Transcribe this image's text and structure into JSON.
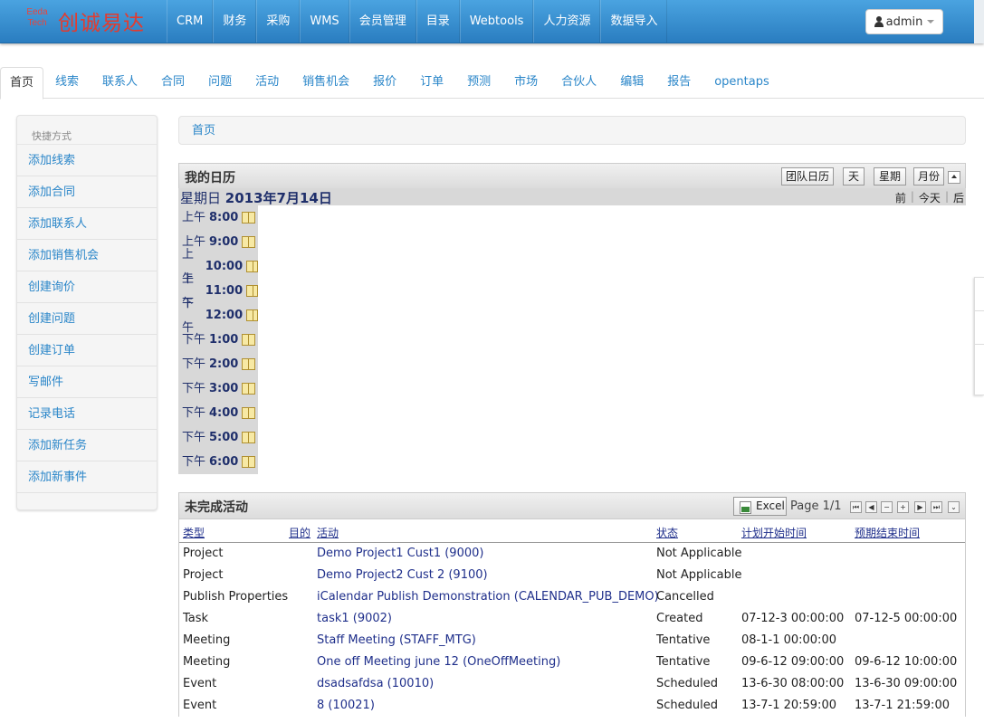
{
  "brand": {
    "logo_text": "创诚易达",
    "logo_small_1": "Eeda",
    "logo_small_2": "Tech"
  },
  "nav": [
    "CRM",
    "财务",
    "采购",
    "WMS",
    "会员管理",
    "目录",
    "Webtools",
    "人力资源",
    "数据导入"
  ],
  "user": {
    "name": "admin"
  },
  "tabs": [
    "首页",
    "线索",
    "联系人",
    "合同",
    "问题",
    "活动",
    "销售机会",
    "报价",
    "订单",
    "预测",
    "市场",
    "合伙人",
    "编辑",
    "报告",
    "opentaps"
  ],
  "sidebar": {
    "header": "快捷方式",
    "items": [
      "添加线索",
      "添加合同",
      "添加联系人",
      "添加销售机会",
      "创建询价",
      "创建问题",
      "创建订单",
      "写邮件",
      "记录电话",
      "添加新任务",
      "添加新事件"
    ]
  },
  "breadcrumb": "首页",
  "calendar": {
    "title": "我的日历",
    "buttons": {
      "team": "团队日历",
      "day": "天",
      "week": "星期",
      "month": "月份"
    },
    "weekday": "星期日",
    "date": "2013年7月14日",
    "nav": {
      "prev": "前",
      "today": "今天",
      "next": "后"
    },
    "hours": [
      {
        "period": "上午",
        "time": "8:00"
      },
      {
        "period": "上午",
        "time": "9:00"
      },
      {
        "period": "上午",
        "time": "10:00"
      },
      {
        "period": "上午",
        "time": "11:00"
      },
      {
        "period": "下午",
        "time": "12:00"
      },
      {
        "period": "下午",
        "time": "1:00"
      },
      {
        "period": "下午",
        "time": "2:00"
      },
      {
        "period": "下午",
        "time": "3:00"
      },
      {
        "period": "下午",
        "time": "4:00"
      },
      {
        "period": "下午",
        "time": "5:00"
      },
      {
        "period": "下午",
        "time": "6:00"
      }
    ]
  },
  "activities": {
    "title": "未完成活动",
    "excel_label": "Excel",
    "page_label": "Page 1/1",
    "columns": {
      "type": "类型",
      "purpose": "目的",
      "activity": "活动",
      "status": "状态",
      "start": "计划开始时间",
      "end": "预期结束时间"
    },
    "rows": [
      {
        "type": "Project",
        "activity": "Demo Project1 Cust1 (9000)",
        "status": "Not Applicable",
        "start": "",
        "end": ""
      },
      {
        "type": "Project",
        "activity": "Demo Project2 Cust 2 (9100)",
        "status": "Not Applicable",
        "start": "",
        "end": ""
      },
      {
        "type": "Publish Properties",
        "activity": "iCalendar Publish Demonstration (CALENDAR_PUB_DEMO)",
        "status": "Cancelled",
        "start": "",
        "end": ""
      },
      {
        "type": "Task",
        "activity": "task1 (9002)",
        "status": "Created",
        "start": "07-12-3 00:00:00",
        "end": "07-12-5 00:00:00"
      },
      {
        "type": "Meeting",
        "activity": "Staff Meeting (STAFF_MTG)",
        "status": "Tentative",
        "start": "08-1-1 00:00:00",
        "end": ""
      },
      {
        "type": "Meeting",
        "activity": "One off Meeting june 12 (OneOffMeeting)",
        "status": "Tentative",
        "start": "09-6-12 09:00:00",
        "end": "09-6-12 10:00:00"
      },
      {
        "type": "Event",
        "activity": "dsadsafdsa (10010)",
        "status": "Scheduled",
        "start": "13-6-30 08:00:00",
        "end": "13-6-30 09:00:00"
      },
      {
        "type": "Event",
        "activity": "8 (10021)",
        "status": "Scheduled",
        "start": "13-7-1 20:59:00",
        "end": "13-7-1 21:59:00"
      }
    ]
  }
}
